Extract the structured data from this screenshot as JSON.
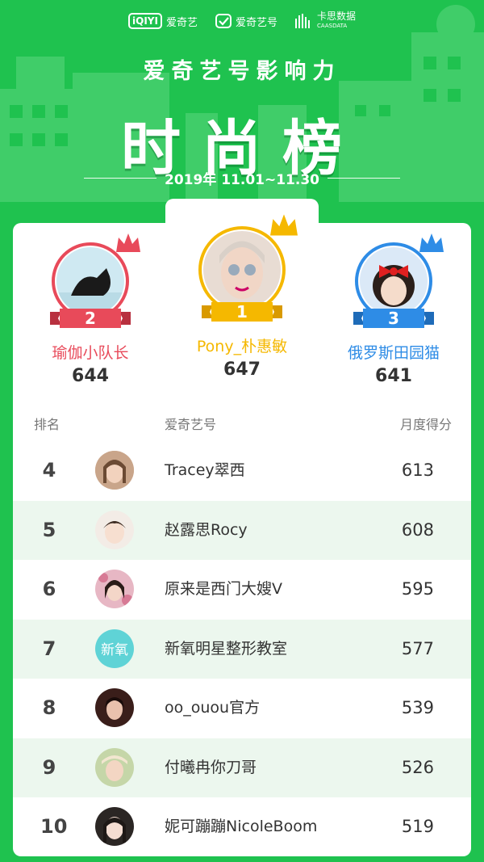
{
  "header": {
    "brand1": "爱奇艺",
    "brand1_logo": "iQIYI",
    "brand2": "爱奇艺号",
    "brand3": "卡思数据",
    "brand3_sub": "CAASDATA",
    "subtitle": "爱奇艺号影响力",
    "title": "时尚榜",
    "date_range": "2019年 11.01~11.30"
  },
  "top3": [
    {
      "rank": "2",
      "name": "瑜伽小队长",
      "score": "644",
      "color": "#e84a5a"
    },
    {
      "rank": "1",
      "name": "Pony_朴惠敏",
      "score": "647",
      "color": "#f5b800"
    },
    {
      "rank": "3",
      "name": "俄罗斯田园猫",
      "score": "641",
      "color": "#2e8ce6"
    }
  ],
  "table": {
    "col_rank": "排名",
    "col_name": "爱奇艺号",
    "col_score": "月度得分",
    "rows": [
      {
        "rank": "4",
        "name": "Tracey翠西",
        "score": "613"
      },
      {
        "rank": "5",
        "name": "赵露思Rocy",
        "score": "608"
      },
      {
        "rank": "6",
        "name": "原来是西门大嫂V",
        "score": "595"
      },
      {
        "rank": "7",
        "name": "新氧明星整形教室",
        "score": "577",
        "avatar_text": "新氧"
      },
      {
        "rank": "8",
        "name": "oo_ouou官方",
        "score": "539"
      },
      {
        "rank": "9",
        "name": "付曦冉你刀哥",
        "score": "526"
      },
      {
        "rank": "10",
        "name": "妮可蹦蹦NicoleBoom",
        "score": "519"
      }
    ]
  },
  "colors": {
    "background": "#1fc24f",
    "row_alt": "#ecf7ee"
  }
}
